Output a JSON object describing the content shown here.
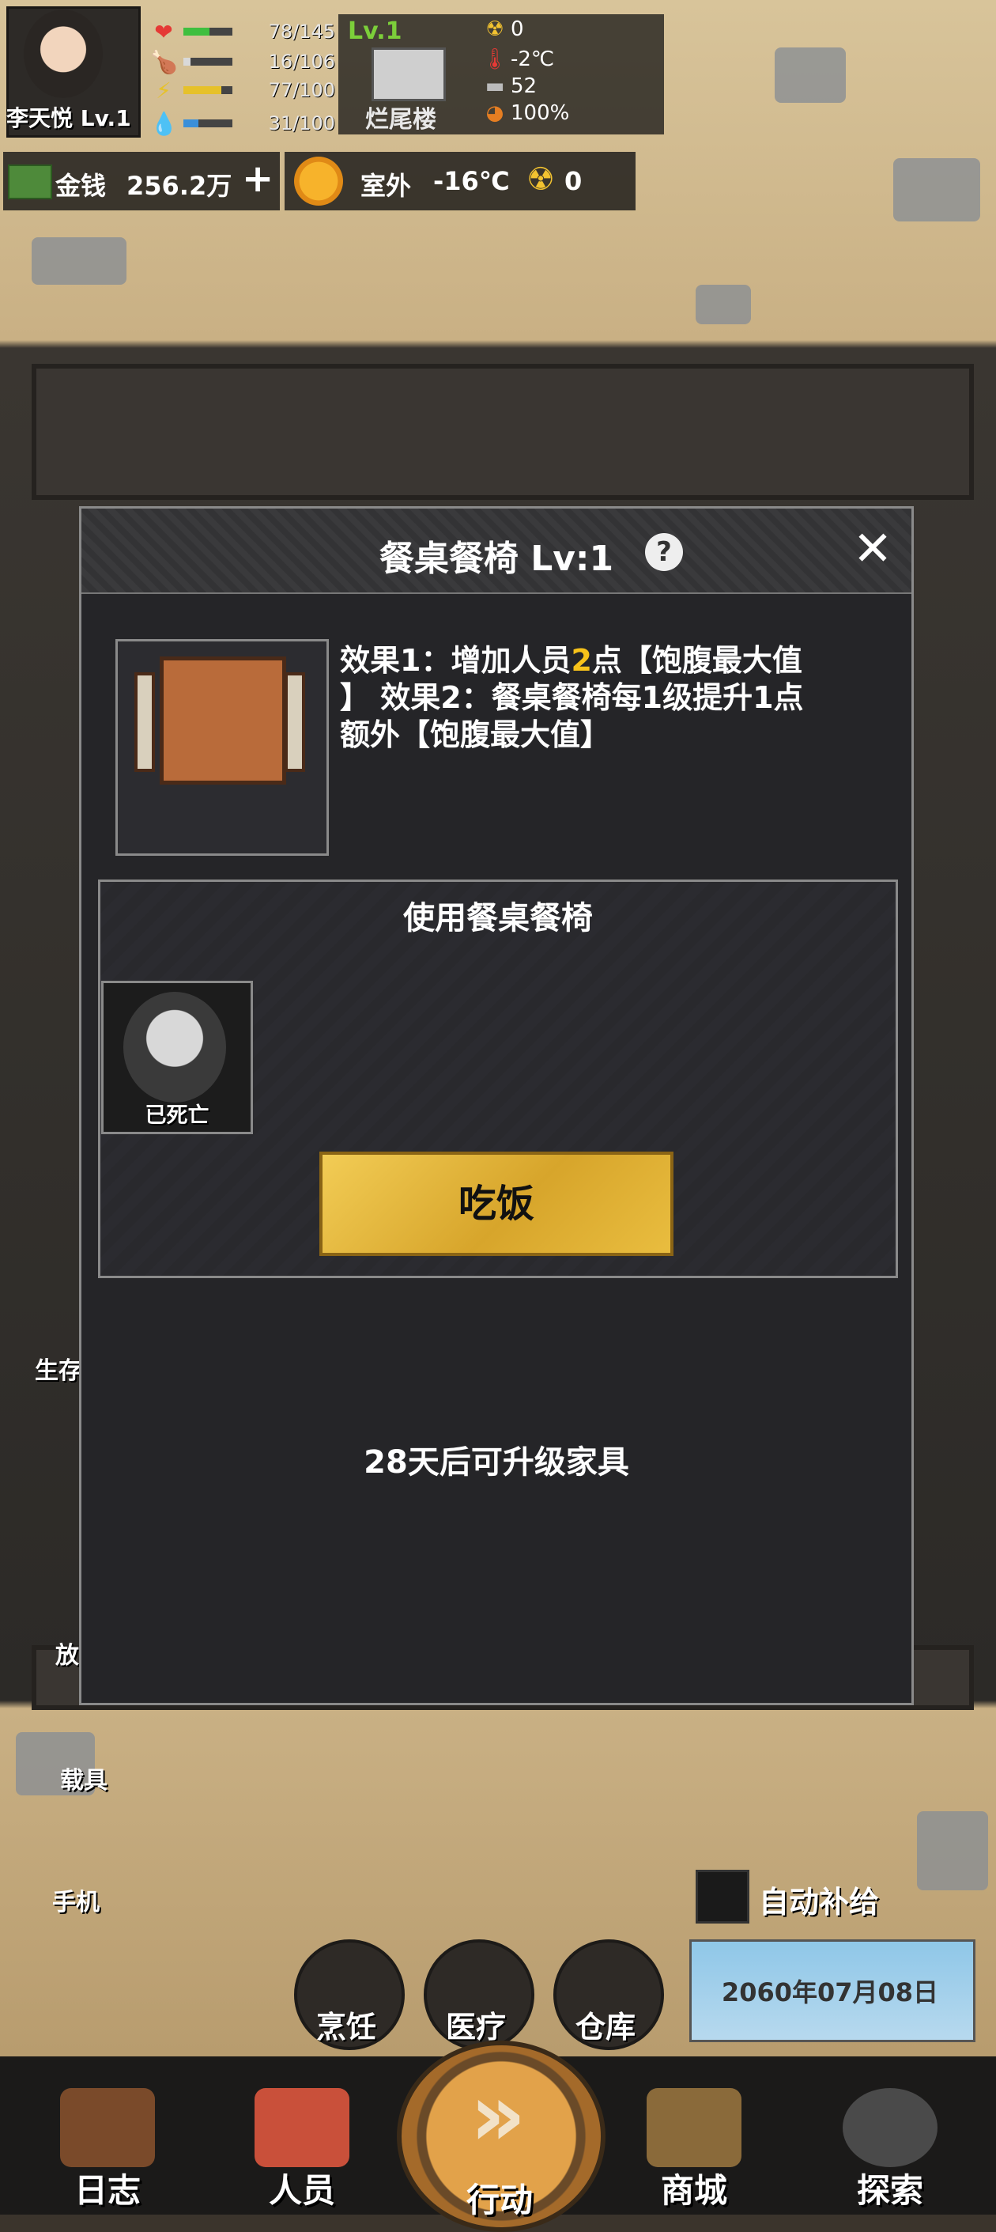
{
  "player": {
    "name": "李天悦 Lv.1"
  },
  "stats": [
    {
      "icon": "heart-icon",
      "glyph": "❤",
      "value": "78/145",
      "fill": 0.54,
      "color": "#3fbf3f"
    },
    {
      "icon": "food-icon",
      "glyph": "🍗",
      "value": "16/106",
      "fill": 0.15,
      "color": "#d9d9d9"
    },
    {
      "icon": "energy-icon",
      "glyph": "⚡",
      "value": "77/100",
      "fill": 0.77,
      "color": "#e6c12a"
    },
    {
      "icon": "water-icon",
      "glyph": "💧",
      "value": "31/100",
      "fill": 0.31,
      "color": "#3a8fd9"
    }
  ],
  "base": {
    "level": "Lv.1",
    "name": "烂尾楼",
    "radiation": "0",
    "temperature": "-2℃",
    "defense": "52",
    "integrity": "100%"
  },
  "resources": {
    "money_label": "金钱",
    "money_value": "256.2万",
    "plus": "+",
    "outside_label": "室外",
    "outside_temp": "-16℃",
    "outside_radiation": "0"
  },
  "dialog": {
    "title": "餐桌餐椅 Lv:1",
    "help": "?",
    "close": "✕",
    "desc_line1_a": "效果1：增加人员",
    "desc_line1_hl": "2",
    "desc_line1_b": "点【饱腹最大值",
    "desc_line2": "】 效果2：餐桌餐椅每1级提升1点",
    "desc_line3": "额外【饱腹最大值】",
    "use_title": "使用餐桌餐椅",
    "member_status": "已死亡",
    "eat_button": "吃饭",
    "upgrade_text": "28天后可升级家具"
  },
  "side_labels": {
    "vehicle": "载具",
    "phone": "手机",
    "survive": "生存",
    "place": "放"
  },
  "bottom": {
    "auto_supply": "自动补给",
    "cook": "烹饪",
    "medical": "医疗",
    "storage": "仓库",
    "date": "2060年07月08日"
  },
  "nav": {
    "log": "日志",
    "members": "人员",
    "action": "行动",
    "action_glyph": "»",
    "shop": "商城",
    "explore": "探索"
  }
}
